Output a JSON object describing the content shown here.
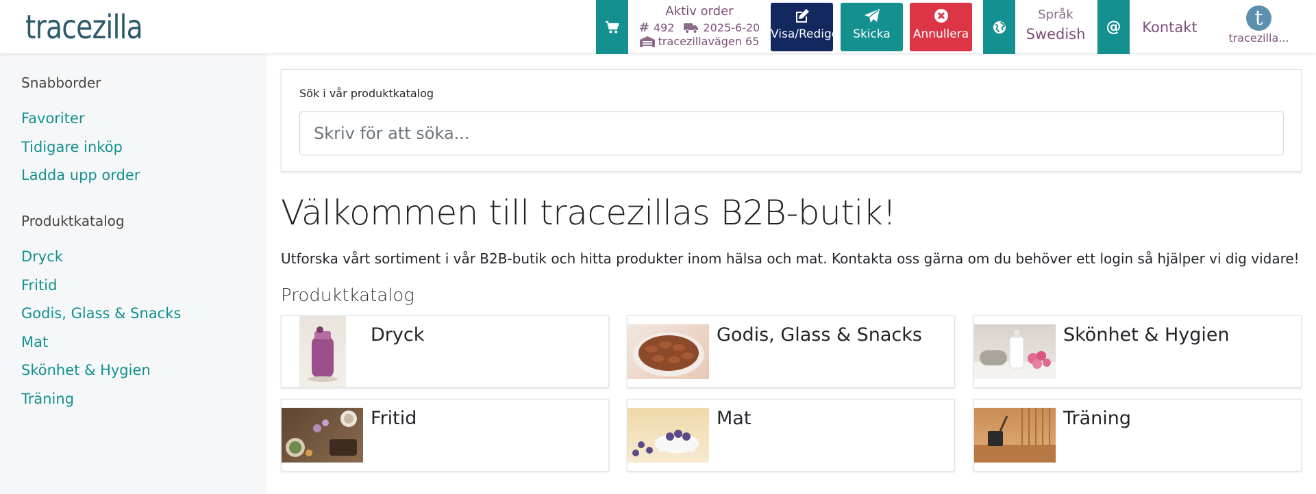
{
  "header": {
    "logo_text": "tracezilla",
    "order": {
      "title": "Aktiv order",
      "number": "492",
      "date": "2025-6-20",
      "address": "tracezillavägen 65"
    },
    "buttons": {
      "edit_label": "Visa/Redigera",
      "send_label": "Skicka",
      "cancel_label": "Annullera"
    },
    "language": {
      "label": "Språk",
      "value": "Swedish"
    },
    "contact_label": "Kontakt",
    "user": {
      "avatar_letter": "t",
      "name": "tracezilla..."
    }
  },
  "sidebar": {
    "quick_order_heading": "Snabborder",
    "quick_links": [
      "Favoriter",
      "Tidigare inköp",
      "Ladda upp order"
    ],
    "catalog_heading": "Produktkatalog",
    "catalog_links": [
      "Dryck",
      "Fritid",
      "Godis, Glass & Snacks",
      "Mat",
      "Skönhet & Hygien",
      "Träning"
    ]
  },
  "search": {
    "label": "Sök i vår produktkatalog",
    "placeholder": "Skriv för att söka..."
  },
  "main": {
    "welcome_title": "Välkommen till tracezillas B2B-butik!",
    "intro_text": "Utforska vårt sortiment i vår B2B-butik och hitta produkter inom hälsa och mat. Kontakta oss gärna om du behöver ett login så hjälper vi dig vidare!",
    "catalog_title": "Produktkatalog",
    "categories": [
      {
        "name": "Dryck"
      },
      {
        "name": "Godis, Glass & Snacks"
      },
      {
        "name": "Skönhet & Hygien"
      },
      {
        "name": "Fritid"
      },
      {
        "name": "Mat"
      },
      {
        "name": "Träning"
      }
    ]
  },
  "colors": {
    "teal": "#13908f",
    "navy": "#12285f",
    "red": "#dc3545",
    "purple_text": "#7d4f7a",
    "logo": "#2d5a6b"
  },
  "icons": [
    "cart-icon",
    "hash-icon",
    "truck-icon",
    "warehouse-icon",
    "edit-icon",
    "send-icon",
    "cancel-icon",
    "globe-icon",
    "at-icon"
  ]
}
